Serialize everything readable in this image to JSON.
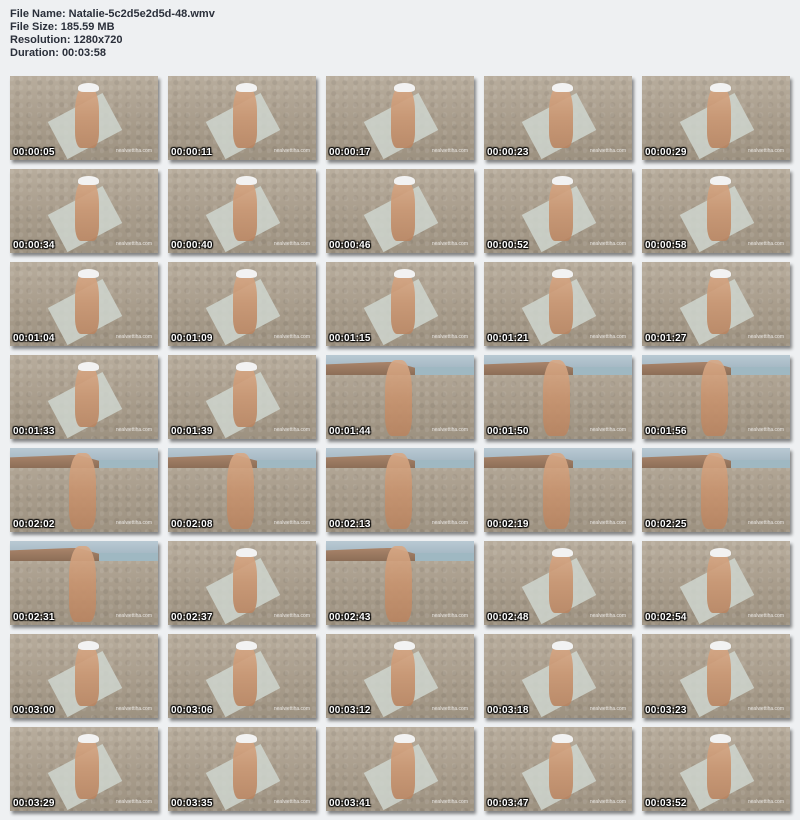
{
  "header": {
    "file_name": "File Name: Natalie-5c2d5e2d5d-48.wmv",
    "file_size": "File Size: 185.59 MB",
    "resolution": "Resolution: 1280x720",
    "duration": "Duration: 00:03:58"
  },
  "thumbnails": [
    {
      "time": "00:00:05",
      "watermark": "nealwettiha.com",
      "scene": "beach"
    },
    {
      "time": "00:00:11",
      "watermark": "nealwettiha.com",
      "scene": "beach"
    },
    {
      "time": "00:00:17",
      "watermark": "nealwettiha.com",
      "scene": "beach"
    },
    {
      "time": "00:00:23",
      "watermark": "nealwettiha.com",
      "scene": "beach"
    },
    {
      "time": "00:00:29",
      "watermark": "nealwettiha.com",
      "scene": "beach"
    },
    {
      "time": "00:00:34",
      "watermark": "nealwettiha.com",
      "scene": "beach"
    },
    {
      "time": "00:00:40",
      "watermark": "nealwettiha.com",
      "scene": "beach"
    },
    {
      "time": "00:00:46",
      "watermark": "nealwettiha.com",
      "scene": "beach"
    },
    {
      "time": "00:00:52",
      "watermark": "nealwettiha.com",
      "scene": "beach"
    },
    {
      "time": "00:00:58",
      "watermark": "nealwettiha.com",
      "scene": "beach"
    },
    {
      "time": "00:01:04",
      "watermark": "nealwettiha.com",
      "scene": "beach"
    },
    {
      "time": "00:01:09",
      "watermark": "nealwettiha.com",
      "scene": "beach"
    },
    {
      "time": "00:01:15",
      "watermark": "nealwettiha.com",
      "scene": "beach"
    },
    {
      "time": "00:01:21",
      "watermark": "nealwettiha.com",
      "scene": "beach"
    },
    {
      "time": "00:01:27",
      "watermark": "nealwettiha.com",
      "scene": "beach"
    },
    {
      "time": "00:01:33",
      "watermark": "nealwettiha.com",
      "scene": "beach"
    },
    {
      "time": "00:01:39",
      "watermark": "nealwettiha.com",
      "scene": "beach"
    },
    {
      "time": "00:01:44",
      "watermark": "nealwettiha.com",
      "scene": "coast"
    },
    {
      "time": "00:01:50",
      "watermark": "nealwettiha.com",
      "scene": "coast"
    },
    {
      "time": "00:01:56",
      "watermark": "nealwettiha.com",
      "scene": "coast"
    },
    {
      "time": "00:02:02",
      "watermark": "nealwettiha.com",
      "scene": "coast"
    },
    {
      "time": "00:02:08",
      "watermark": "nealwettiha.com",
      "scene": "coast"
    },
    {
      "time": "00:02:13",
      "watermark": "nealwettiha.com",
      "scene": "coast"
    },
    {
      "time": "00:02:19",
      "watermark": "nealwettiha.com",
      "scene": "coast"
    },
    {
      "time": "00:02:25",
      "watermark": "nealwettiha.com",
      "scene": "coast"
    },
    {
      "time": "00:02:31",
      "watermark": "nealwettiha.com",
      "scene": "coast"
    },
    {
      "time": "00:02:37",
      "watermark": "nealwettiha.com",
      "scene": "beach"
    },
    {
      "time": "00:02:43",
      "watermark": "nealwettiha.com",
      "scene": "coast"
    },
    {
      "time": "00:02:48",
      "watermark": "nealwettiha.com",
      "scene": "beach"
    },
    {
      "time": "00:02:54",
      "watermark": "nealwettiha.com",
      "scene": "beach"
    },
    {
      "time": "00:03:00",
      "watermark": "nealwettiha.com",
      "scene": "beach"
    },
    {
      "time": "00:03:06",
      "watermark": "nealwettiha.com",
      "scene": "beach"
    },
    {
      "time": "00:03:12",
      "watermark": "nealwettiha.com",
      "scene": "beach"
    },
    {
      "time": "00:03:18",
      "watermark": "nealwettiha.com",
      "scene": "beach"
    },
    {
      "time": "00:03:23",
      "watermark": "nealwettiha.com",
      "scene": "beach"
    },
    {
      "time": "00:03:29",
      "watermark": "nealwettiha.com",
      "scene": "beach"
    },
    {
      "time": "00:03:35",
      "watermark": "nealwettiha.com",
      "scene": "beach"
    },
    {
      "time": "00:03:41",
      "watermark": "nealwettiha.com",
      "scene": "beach"
    },
    {
      "time": "00:03:47",
      "watermark": "nealwettiha.com",
      "scene": "beach"
    },
    {
      "time": "00:03:52",
      "watermark": "nealwettiha.com",
      "scene": "beach"
    }
  ]
}
